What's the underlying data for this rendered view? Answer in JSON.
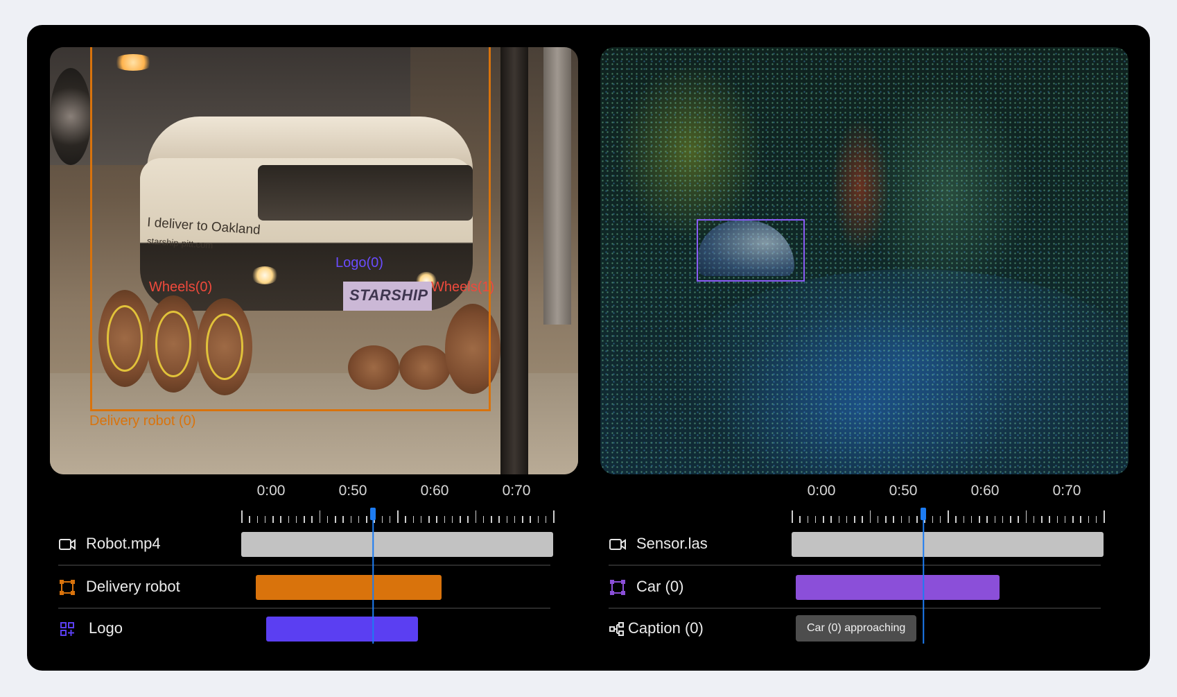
{
  "left_panel": {
    "file_name": "Robot.mp4",
    "robot_text_line1": "I deliver to Oakland",
    "robot_text_line2": "starship-pitt.com",
    "logo_text": "STARSHIP",
    "annotations": {
      "delivery_robot": "Delivery robot (0)",
      "wheels0": "Wheels(0)",
      "wheels1": "Wheels(1)",
      "logo": "Logo(0)"
    },
    "timeline": {
      "ticks": [
        "0:00",
        "0:50",
        "0:60",
        "0:70"
      ],
      "rows": [
        {
          "label": "Robot.mp4",
          "icon": "video-icon"
        },
        {
          "label": "Delivery robot",
          "icon": "bounding-box-icon"
        },
        {
          "label": "Logo",
          "icon": "grid-plus-icon"
        }
      ]
    }
  },
  "right_panel": {
    "file_name": "Sensor.las",
    "timeline": {
      "ticks": [
        "0:00",
        "0:50",
        "0:60",
        "0:70"
      ],
      "rows": [
        {
          "label": "Sensor.las",
          "icon": "video-icon"
        },
        {
          "label": "Car (0)",
          "icon": "bounding-box-icon"
        },
        {
          "label": "Caption (0)",
          "icon": "caption-tree-icon"
        }
      ],
      "caption_chip": "Car (0) approaching"
    }
  },
  "colors": {
    "delivery_robot": "#d9730c",
    "logo": "#5b3ff2",
    "car": "#8b4fd9",
    "file_track": "#c2c2c2",
    "playhead": "#1d7cf2",
    "wheels": "#ef4a3c"
  }
}
